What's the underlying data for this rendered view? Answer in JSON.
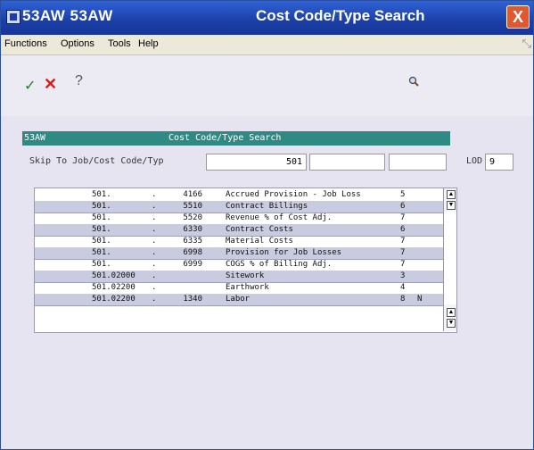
{
  "window": {
    "title_left": "53AW  53AW",
    "title_center": "Cost Code/Type Search",
    "close_glyph": "X"
  },
  "menu": [
    "Functions",
    "Options",
    "Tools",
    "Help"
  ],
  "toolbar": {
    "ok_icon": "checkmark-icon",
    "cancel_icon": "cancel-icon",
    "help_label": "?",
    "search_icon": "search-icon"
  },
  "form": {
    "header_left": "53AW",
    "header_center": "Cost Code/Type Search",
    "skip_label": "Skip To Job/Cost Code/Typ",
    "skip_job_value": "501",
    "skip_code_value": "",
    "skip_type_value": "",
    "lod_label": "LOD",
    "lod_value": "9"
  },
  "rows": [
    {
      "job": "501.",
      "dot": ".",
      "code": "4166",
      "desc": "Accrued Provision - Job Loss",
      "lod": "5",
      "flag": "",
      "shade": false
    },
    {
      "job": "501.",
      "dot": ".",
      "code": "5510",
      "desc": "Contract Billings",
      "lod": "6",
      "flag": "",
      "shade": true
    },
    {
      "job": "501.",
      "dot": ".",
      "code": "5520",
      "desc": "Revenue % of Cost Adj.",
      "lod": "7",
      "flag": "",
      "shade": false
    },
    {
      "job": "501.",
      "dot": ".",
      "code": "6330",
      "desc": "Contract Costs",
      "lod": "6",
      "flag": "",
      "shade": true
    },
    {
      "job": "501.",
      "dot": ".",
      "code": "6335",
      "desc": "Material Costs",
      "lod": "7",
      "flag": "",
      "shade": false
    },
    {
      "job": "501.",
      "dot": ".",
      "code": "6998",
      "desc": "Provision for Job Losses",
      "lod": "7",
      "flag": "",
      "shade": true
    },
    {
      "job": "501.",
      "dot": ".",
      "code": "6999",
      "desc": "COGS % of Billing Adj.",
      "lod": "7",
      "flag": "",
      "shade": false
    },
    {
      "job": "501.02000",
      "dot": ".",
      "code": "",
      "desc": "Sitework",
      "lod": "3",
      "flag": "",
      "shade": true
    },
    {
      "job": "501.02200",
      "dot": ".",
      "code": "",
      "desc": "Earthwork",
      "lod": "4",
      "flag": "",
      "shade": false
    },
    {
      "job": "501.02200",
      "dot": ".",
      "code": "1340",
      "desc": "Labor",
      "lod": "8",
      "flag": "N",
      "shade": true
    }
  ],
  "colors": {
    "title_bar": "#1b3fa6",
    "header_bar": "#2f8a83",
    "row_shade": "#c9cbe0"
  }
}
